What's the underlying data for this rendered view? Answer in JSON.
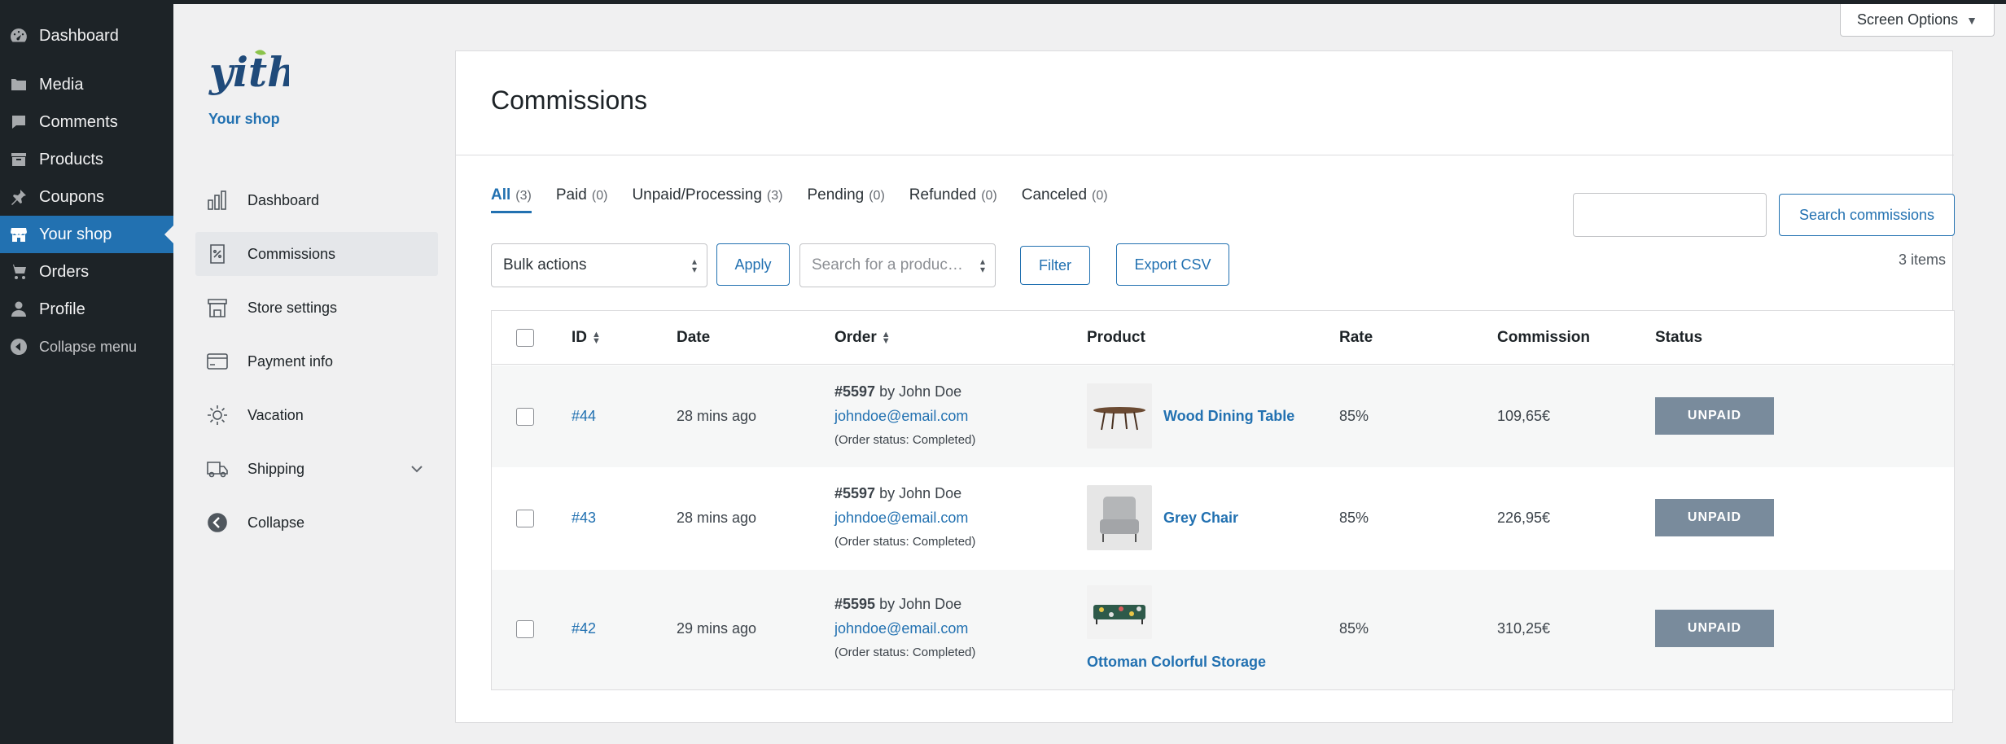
{
  "wp_menu": {
    "items": [
      {
        "label": "Dashboard",
        "icon": "gauge-icon"
      },
      {
        "label": "Media",
        "icon": "media-icon"
      },
      {
        "label": "Comments",
        "icon": "comment-icon"
      },
      {
        "label": "Products",
        "icon": "archive-icon"
      },
      {
        "label": "Coupons",
        "icon": "pin-icon"
      },
      {
        "label": "Your shop",
        "icon": "store-icon"
      },
      {
        "label": "Orders",
        "icon": "cart-icon"
      },
      {
        "label": "Profile",
        "icon": "user-icon"
      }
    ],
    "collapse_label": "Collapse menu"
  },
  "screen_options": {
    "label": "Screen Options",
    "arrow": "▼"
  },
  "vendor": {
    "logo_text": "yith",
    "shop_name": "Your shop",
    "items": [
      {
        "label": "Dashboard",
        "icon": "bar-chart-icon"
      },
      {
        "label": "Commissions",
        "icon": "commission-doc-icon"
      },
      {
        "label": "Store settings",
        "icon": "storefront-icon"
      },
      {
        "label": "Payment info",
        "icon": "credit-card-icon"
      },
      {
        "label": "Vacation",
        "icon": "sun-icon"
      },
      {
        "label": "Shipping",
        "icon": "truck-icon"
      },
      {
        "label": "Collapse",
        "icon": "arrow-left-circle-icon"
      }
    ]
  },
  "page": {
    "title": "Commissions",
    "tabs": [
      {
        "label": "All",
        "count": "(3)"
      },
      {
        "label": "Paid",
        "count": "(0)"
      },
      {
        "label": "Unpaid/Processing",
        "count": "(3)"
      },
      {
        "label": "Pending",
        "count": "(0)"
      },
      {
        "label": "Refunded",
        "count": "(0)"
      },
      {
        "label": "Canceled",
        "count": "(0)"
      }
    ],
    "search_button": "Search commissions",
    "items_count": "3 items",
    "bulk_actions": "Bulk actions",
    "apply": "Apply",
    "product_placeholder": "Search for a produc…",
    "filter": "Filter",
    "export": "Export CSV"
  },
  "table": {
    "columns": {
      "id": "ID",
      "date": "Date",
      "order": "Order",
      "product": "Product",
      "rate": "Rate",
      "commission": "Commission",
      "status": "Status"
    },
    "rows": [
      {
        "id": "#44",
        "date": "28 mins ago",
        "order_num": "#5597",
        "order_by": "by John Doe",
        "email": "johndoe@email.com",
        "order_status": "(Order status: Completed)",
        "product": "Wood Dining Table",
        "rate": "85%",
        "commission": "109,65€",
        "status": "UNPAID"
      },
      {
        "id": "#43",
        "date": "28 mins ago",
        "order_num": "#5597",
        "order_by": "by John Doe",
        "email": "johndoe@email.com",
        "order_status": "(Order status: Completed)",
        "product": "Grey Chair",
        "rate": "85%",
        "commission": "226,95€",
        "status": "UNPAID"
      },
      {
        "id": "#42",
        "date": "29 mins ago",
        "order_num": "#5595",
        "order_by": "by John Doe",
        "email": "johndoe@email.com",
        "order_status": "(Order status: Completed)",
        "product": "Ottoman Colorful Storage",
        "rate": "85%",
        "commission": "310,25€",
        "status": "UNPAID"
      }
    ]
  },
  "colors": {
    "accent": "#2271b1",
    "admin_bg": "#1d2327",
    "badge": "#798b9c"
  }
}
